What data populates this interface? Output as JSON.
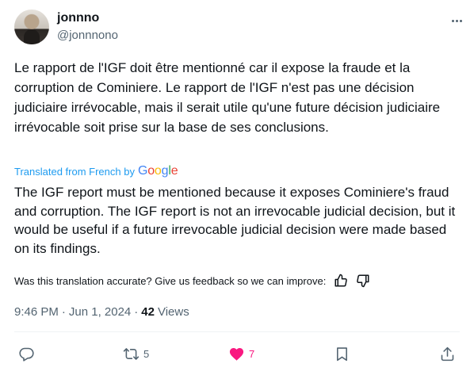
{
  "author": {
    "display_name": "jonnno",
    "handle": "@jonnnono"
  },
  "tweet": {
    "original_text": "Le rapport de l'IGF doit être mentionné car il expose la fraude et la corruption de Cominiere. Le rapport de l'IGF n'est pas une décision judiciaire irrévocable, mais il serait utile qu'une future décision judiciaire irrévocable soit prise sur la base de ses conclusions.",
    "translated_label": "Translated from French by",
    "google_letters": [
      "G",
      "o",
      "o",
      "g",
      "l",
      "e"
    ],
    "translation_text": "The IGF report must be mentioned because it exposes Cominiere's fraud and corruption. The IGF report is not an irrevocable judicial decision, but it would be useful if a future irrevocable judicial decision were made based on its findings.",
    "feedback_prompt": "Was this translation accurate? Give us feedback so we can improve:",
    "time": "9:46 PM",
    "separator": "·",
    "date": "Jun 1, 2024",
    "views_count": "42",
    "views_label": "Views"
  },
  "actions": {
    "reply_count": "",
    "retweet_count": "5",
    "like_count": "7"
  },
  "colors": {
    "text": "#0f1419",
    "secondary": "#536471",
    "link": "#1d9bf0",
    "like": "#f91880",
    "divider": "#eff3f4"
  },
  "icons": [
    "more-icon",
    "thumbs-up-icon",
    "thumbs-down-icon",
    "reply-icon",
    "retweet-icon",
    "like-icon",
    "bookmark-icon",
    "share-icon"
  ]
}
